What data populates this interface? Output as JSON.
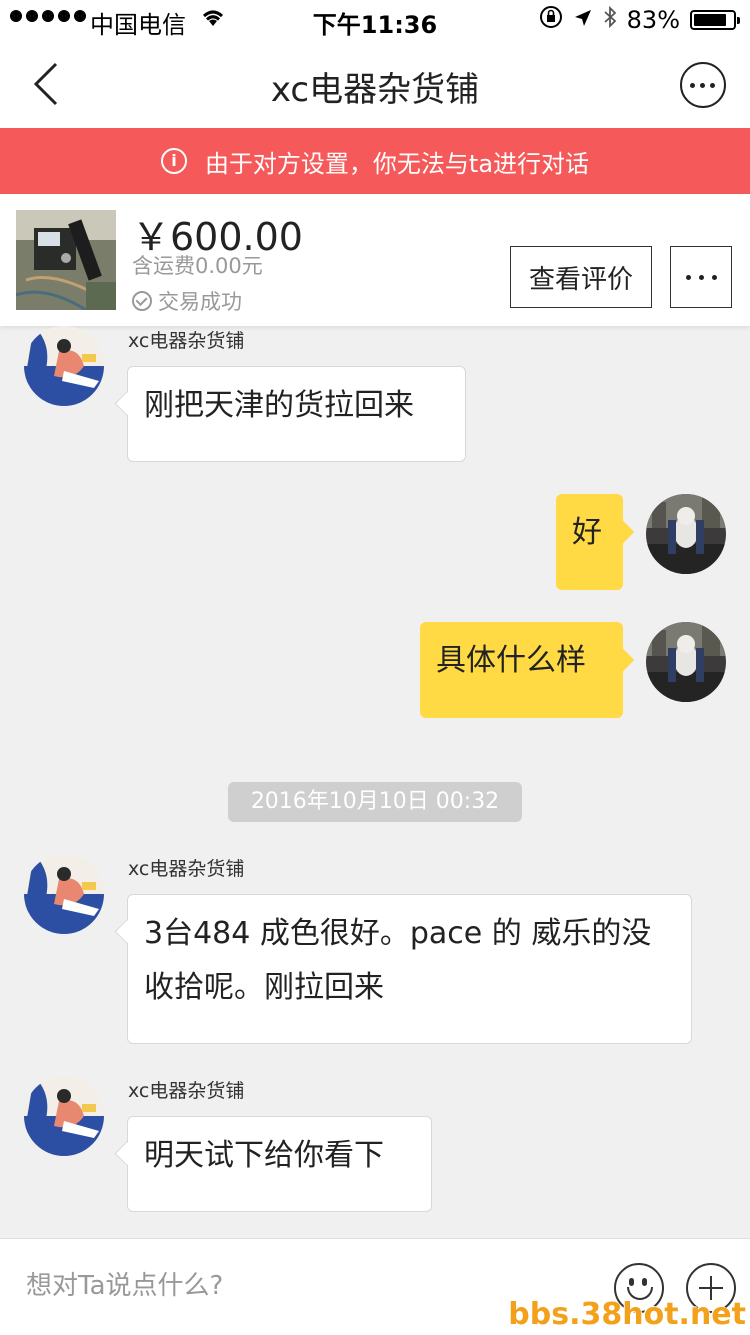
{
  "status_bar": {
    "carrier": "中国电信",
    "time": "下午11:36",
    "battery": "83%",
    "battery_level": 0.83
  },
  "nav": {
    "title": "xc电器杂货铺"
  },
  "banner": {
    "text": "由于对方设置，你无法与ta进行对话"
  },
  "product": {
    "price": "￥600.00",
    "shipping": "含运费0.00元",
    "status": "交易成功",
    "review_button": "查看评价"
  },
  "messages": [
    {
      "side": "left",
      "sender": "xc电器杂货铺",
      "text": "刚把天津的货拉回来"
    },
    {
      "side": "right",
      "text": "好"
    },
    {
      "side": "right",
      "text": "具体什么样"
    },
    {
      "side": "left",
      "sender": "xc电器杂货铺",
      "text": "3台484 成色很好。pace 的 威乐的没收拾呢。刚拉回来"
    },
    {
      "side": "left",
      "sender": "xc电器杂货铺",
      "text": "明天试下给你看下"
    }
  ],
  "timestamp": "2016年10月10日 00:32",
  "input": {
    "placeholder": "想对Ta说点什么?"
  },
  "watermark": "bbs.38hot.net",
  "colors": {
    "banner": "#f55959",
    "my_bubble": "#ffda44",
    "background": "#f0f0f0"
  }
}
